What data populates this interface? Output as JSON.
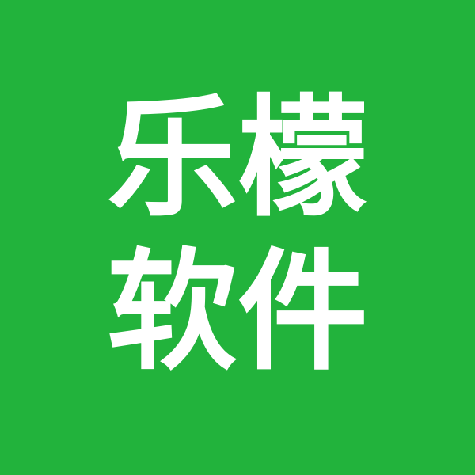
{
  "logo": {
    "line1": "乐檬",
    "line2": "软件",
    "background_color": "#22b33c",
    "text_color": "#ffffff"
  }
}
